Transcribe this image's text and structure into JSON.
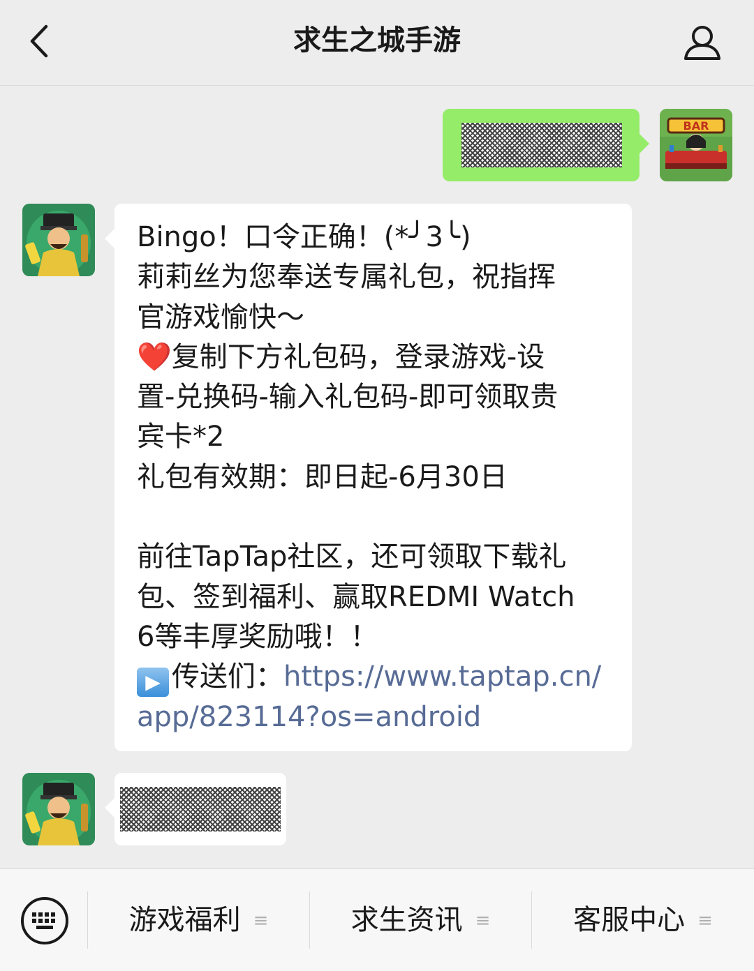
{
  "header": {
    "title": "求生之城手游",
    "back_icon": "chevron-left-icon",
    "profile_icon": "person-icon"
  },
  "messages": [
    {
      "side": "right",
      "type": "redacted"
    },
    {
      "side": "left",
      "type": "text",
      "lines": [
        "Bingo！口令正确！(*╯3╰)",
        "莉莉丝为您奉送专属礼包，祝指挥",
        "官游戏愉快～",
        "复制下方礼包码，登录游戏-设",
        "置-兑换码-输入礼包码-即可领取贵",
        "宾卡*2",
        "礼包有效期：即日起-6月30日",
        "",
        "前往TapTap社区，还可领取下载礼",
        "包、签到福利、赢取REDMI Watch",
        "6等丰厚奖励哦！！",
        "传送们：",
        "app/823114?os=android"
      ],
      "link_part1": "https://www.taptap.cn/",
      "heart_emoji": "❤️",
      "play_emoji": "▶"
    },
    {
      "side": "left",
      "type": "redacted"
    }
  ],
  "menu": {
    "keyboard_icon": "keyboard-icon",
    "items": [
      {
        "label": "游戏福利"
      },
      {
        "label": "求生资讯"
      },
      {
        "label": "客服中心"
      }
    ],
    "submenu_icon": "≡"
  },
  "colors": {
    "background": "#ededed",
    "bubble_self": "#95ec69",
    "bubble_other": "#ffffff",
    "link": "#576b95"
  }
}
